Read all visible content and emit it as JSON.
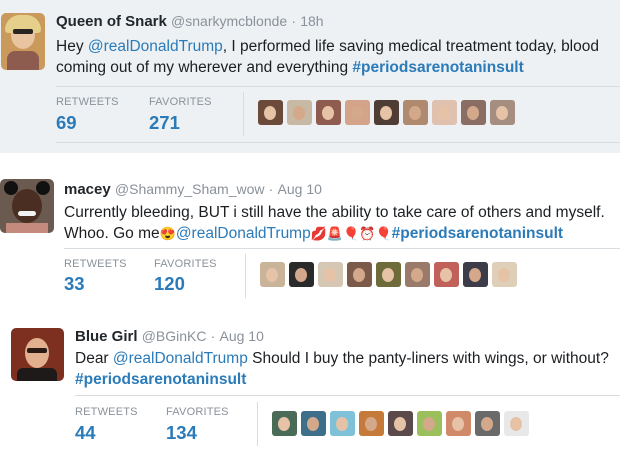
{
  "tweets": [
    {
      "name": "Queen of Snark",
      "handle": "@snarkymcblonde",
      "sep": "·",
      "time": "18h",
      "text_parts": [
        {
          "t": "Hey ",
          "k": "text"
        },
        {
          "t": "@realDonaldTrump",
          "k": "mention"
        },
        {
          "t": ", I performed life saving medical treatment today, blood coming out of my wherever and everything ",
          "k": "text"
        },
        {
          "t": "#periodsarenotaninsult",
          "k": "hashtag"
        }
      ],
      "retweets_label": "RETWEETS",
      "retweets": "69",
      "favorites_label": "FAVORITES",
      "favorites": "271",
      "avatar_colors": [
        "#c89b5e",
        "#e8c58a"
      ],
      "liker_colors": [
        "#6b4a3a",
        "#c8b9a5",
        "#8d5c4e",
        "#d4a48a",
        "#4f3d35",
        "#b08a6e",
        "#e0c1b0",
        "#8a6e63",
        "#a58d80"
      ]
    },
    {
      "name": "macey",
      "handle": "@Shammy_Sham_wow",
      "sep": "·",
      "time": "Aug 10",
      "text_parts": [
        {
          "t": "Currently bleeding, BUT i still have the ability to take care of others and myself. Whoo. Go me",
          "k": "text"
        },
        {
          "t": "😍",
          "k": "emoji"
        },
        {
          "t": "@realDonaldTrump",
          "k": "mention"
        },
        {
          "t": "💋🚨🎈⏰🎈",
          "k": "emoji"
        },
        {
          "t": "#periodsarenotaninsult",
          "k": "hashtag"
        }
      ],
      "retweets_label": "RETWEETS",
      "retweets": "33",
      "favorites_label": "FAVORITES",
      "favorites": "120",
      "avatar_colors": [
        "#3a2a22",
        "#5b3b2b"
      ],
      "liker_colors": [
        "#c9b49a",
        "#2a2a2a",
        "#d6c7b4",
        "#7b5a4a",
        "#6e6b3a",
        "#9a7a6a",
        "#c0625a",
        "#3d3d4a",
        "#e0cfb8"
      ]
    },
    {
      "name": "Blue Girl",
      "handle": "@BGinKC",
      "sep": "·",
      "time": "Aug 10",
      "text_parts": [
        {
          "t": "Dear ",
          "k": "text"
        },
        {
          "t": "@realDonaldTrump",
          "k": "mention"
        },
        {
          "t": " Should I buy the panty-liners with wings, or without? ",
          "k": "text"
        },
        {
          "t": "#periodsarenotaninsult",
          "k": "hashtag"
        }
      ],
      "retweets_label": "RETWEETS",
      "retweets": "44",
      "favorites_label": "FAVORITES",
      "favorites": "134",
      "avatar_colors": [
        "#8b3a2a",
        "#d9a77e"
      ],
      "liker_colors": [
        "#4a6b55",
        "#3d6f8a",
        "#7ec1d9",
        "#c57a3a",
        "#5a4a4a",
        "#9bbf5a",
        "#d08a6a",
        "#6a6a6a",
        "#e8e8e8"
      ]
    }
  ]
}
